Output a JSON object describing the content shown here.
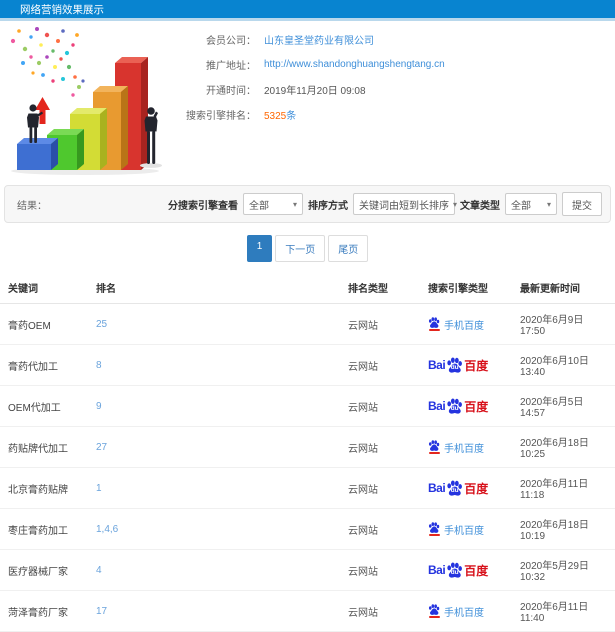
{
  "header": {
    "title": "网络营销效果展示"
  },
  "info": {
    "rows": [
      {
        "label": "会员公司：",
        "value": "山东皇圣堂药业有限公司"
      },
      {
        "label": "推广地址：",
        "value": "http://www.shandonghuangshengtang.cn"
      },
      {
        "label": "开通时间：",
        "value": "2019年11月20日 09:08"
      },
      {
        "label": "搜索引擎排名：",
        "number": "5325",
        "unit": "条"
      }
    ]
  },
  "filters": {
    "section_label": "结果：",
    "engine_label": "分搜索引擎查看",
    "engine_value": "全部",
    "sort_label": "排序方式",
    "sort_value": "关键词由短到长排序",
    "type_label": "文章类型",
    "type_value": "全部",
    "submit_label": "提交"
  },
  "icons": {
    "dropdown_caret": "▾"
  },
  "pagination": {
    "current": "1",
    "next": "下一页",
    "last": "尾页"
  },
  "logos": {
    "bai": "Bai",
    "du": "du",
    "baidu_cn": "百度",
    "mobile_label": "手机百度"
  },
  "table": {
    "headers": [
      "关键词",
      "排名",
      "排名类型",
      "搜索引擎类型",
      "最新更新时间"
    ],
    "rows": [
      {
        "keyword": "膏药OEM",
        "rank": "25",
        "rank_type": "云网站",
        "engine_class": "engine mobile",
        "engine_name": "手机百度",
        "time": "2020年6月9日 17:50"
      },
      {
        "keyword": "膏药代加工",
        "rank": "8",
        "rank_type": "云网站",
        "engine_class": "engine pc",
        "engine_name": "百度",
        "time": "2020年6月10日 13:40"
      },
      {
        "keyword": "OEM代加工",
        "rank": "9",
        "rank_type": "云网站",
        "engine_class": "engine pc",
        "engine_name": "百度",
        "time": "2020年6月5日 14:57"
      },
      {
        "keyword": "药贴牌代加工",
        "rank": "27",
        "rank_type": "云网站",
        "engine_class": "engine mobile",
        "engine_name": "手机百度",
        "time": "2020年6月18日 10:25"
      },
      {
        "keyword": "北京膏药贴牌",
        "rank": "1",
        "rank_type": "云网站",
        "engine_class": "engine pc",
        "engine_name": "百度",
        "time": "2020年6月11日 11:18"
      },
      {
        "keyword": "枣庄膏药加工",
        "rank": "1,4,6",
        "rank_type": "云网站",
        "engine_class": "engine mobile",
        "engine_name": "手机百度",
        "time": "2020年6月18日 10:19"
      },
      {
        "keyword": "医疗器械厂家",
        "rank": "4",
        "rank_type": "云网站",
        "engine_class": "engine pc",
        "engine_name": "百度",
        "time": "2020年5月29日 10:32"
      },
      {
        "keyword": "菏泽膏药厂家",
        "rank": "17",
        "rank_type": "云网站",
        "engine_class": "engine mobile",
        "engine_name": "手机百度",
        "time": "2020年6月11日 11:40"
      }
    ]
  },
  "colors": {
    "header_bg": "#0884d0",
    "link_blue": "#3f8fd9",
    "count_orange": "#ff6600",
    "baidu_blue": "#2534df",
    "baidu_red": "#d7111b",
    "pagination_active": "#2e7cbe"
  }
}
